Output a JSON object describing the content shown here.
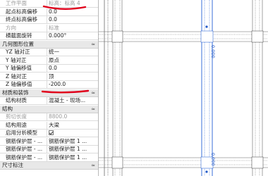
{
  "properties": {
    "rows": [
      {
        "kind": "prop",
        "label": "工作平面",
        "value": "标高：标高 4",
        "disabled": true
      },
      {
        "kind": "prop",
        "label": "起点标高偏移",
        "value": "0.0",
        "disabled": false
      },
      {
        "kind": "prop",
        "label": "终点标高偏移",
        "value": "0.0",
        "disabled": false
      },
      {
        "kind": "prop",
        "label": "方向",
        "value": "标准",
        "disabled": true
      },
      {
        "kind": "prop",
        "label": "横截面旋转",
        "value": "0.000°",
        "disabled": false
      },
      {
        "kind": "cat",
        "label": "几何图形位置",
        "toggle": "≈"
      },
      {
        "kind": "prop",
        "label": "YZ 轴对正",
        "value": "统一",
        "disabled": false
      },
      {
        "kind": "prop",
        "label": "Y 轴对正",
        "value": "原点",
        "disabled": false
      },
      {
        "kind": "prop",
        "label": "Y 轴偏移值",
        "value": "0.0",
        "disabled": false
      },
      {
        "kind": "prop",
        "label": "Z 轴对正",
        "value": "顶",
        "disabled": false
      },
      {
        "kind": "prop",
        "label": "Z 轴偏移值",
        "value": "-200.0",
        "disabled": false
      },
      {
        "kind": "cat",
        "label": "材质和装饰",
        "toggle": "≈"
      },
      {
        "kind": "prop",
        "label": "结构材质",
        "value": "混凝土 - 现场...",
        "disabled": false
      },
      {
        "kind": "cat",
        "label": "结构",
        "toggle": "≈"
      },
      {
        "kind": "prop",
        "label": "剪切长度",
        "value": "8800.0",
        "disabled": true
      },
      {
        "kind": "prop",
        "label": "结构用途",
        "value": "大梁",
        "disabled": false
      },
      {
        "kind": "prop",
        "label": "启用分析模型",
        "value": "",
        "checkbox": true,
        "disabled": false
      },
      {
        "kind": "prop",
        "label": "钢筋保护层 - ...",
        "value": "钢筋保护层 1 ...",
        "disabled": false
      },
      {
        "kind": "prop",
        "label": "钢筋保护层 - ...",
        "value": "钢筋保护层 1 ...",
        "disabled": false
      },
      {
        "kind": "prop",
        "label": "钢筋保护层 - ...",
        "value": "钢筋保护层 1 ...",
        "disabled": false
      },
      {
        "kind": "cat",
        "label": "尺寸标注",
        "toggle": "≈"
      }
    ]
  },
  "canvas": {
    "beam_tag_top": "0.000",
    "beam_tag_bottom": "0.000"
  },
  "colors": {
    "annotation": "#e0001b",
    "beam_tag": "#1f57c7",
    "selected_beam": "#3a6fd8"
  }
}
